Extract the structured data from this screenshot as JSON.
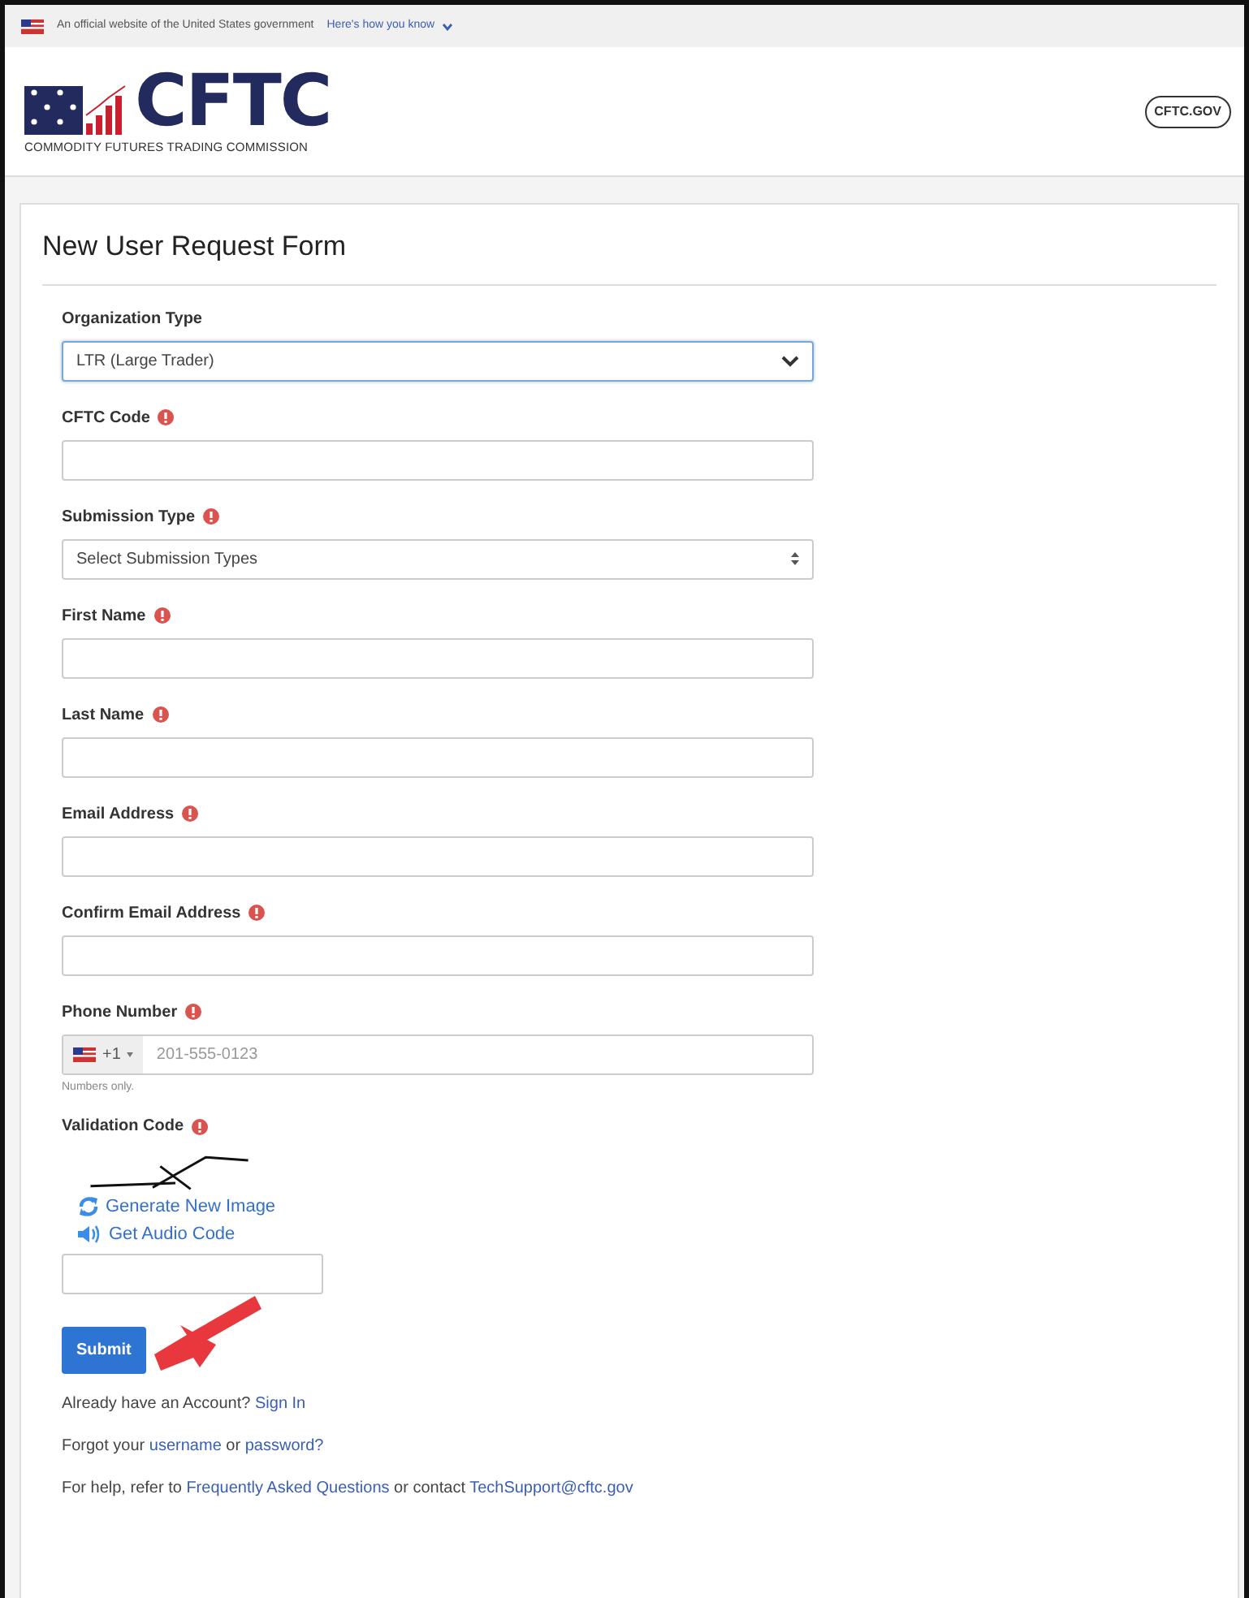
{
  "banner": {
    "text": "An official website of the United States government",
    "link": "Here's how you know",
    "expanded": false
  },
  "header": {
    "logo_text": "CFTC",
    "logo_subtitle": "COMMODITY FUTURES TRADING COMMISSION",
    "badge": "CFTC.GOV"
  },
  "form": {
    "title": "New User Request Form",
    "fields": [
      {
        "kind": "select",
        "label": "Organization Type",
        "required": false,
        "value": "LTR (Large Trader)",
        "focused": true
      },
      {
        "kind": "text",
        "label": "CFTC Code",
        "required": true,
        "focused": false
      },
      {
        "kind": "multiselect",
        "label": "Submission Type",
        "required": true,
        "value": "Select Submission Types",
        "focused": false
      },
      {
        "kind": "text",
        "label": "First Name",
        "required": true,
        "focused": false
      },
      {
        "kind": "text",
        "label": "Last Name",
        "required": true,
        "focused": false
      },
      {
        "kind": "text",
        "label": "Email Address",
        "required": true,
        "focused": false
      },
      {
        "kind": "text",
        "label": "Confirm Email Address",
        "required": true,
        "focused": false
      },
      {
        "kind": "phone",
        "label": "Phone Number",
        "required": true,
        "country_code": "+1",
        "placeholder": "201-555-0123",
        "help": "Numbers only.",
        "focused": false
      },
      {
        "kind": "captcha",
        "label": "Validation Code",
        "required": true,
        "links": [
          "Generate New Image",
          "Get Audio Code"
        ],
        "focused": false
      }
    ],
    "submit": "Submit",
    "footer_lines": [
      [
        {
          "kind": "text",
          "text": "Already have an Account? "
        },
        {
          "kind": "link",
          "text": "Sign In"
        }
      ],
      [
        {
          "kind": "text",
          "text": "Forgot your "
        },
        {
          "kind": "link",
          "text": "username"
        },
        {
          "kind": "text",
          "text": " or "
        },
        {
          "kind": "link",
          "text": "password?"
        }
      ],
      [
        {
          "kind": "text",
          "text": "For help, refer to "
        },
        {
          "kind": "link",
          "text": "Frequently Asked Questions"
        },
        {
          "kind": "text",
          "text": " or contact "
        },
        {
          "kind": "link",
          "text": "TechSupport@cftc.gov"
        }
      ]
    ]
  }
}
